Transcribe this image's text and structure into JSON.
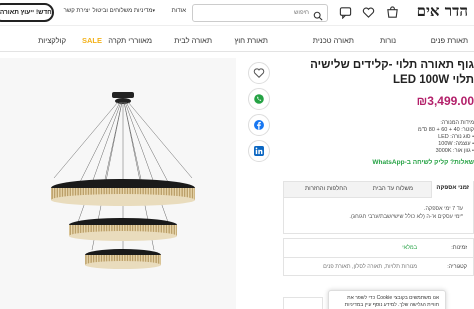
{
  "header": {
    "logo": "הדר אים",
    "search_placeholder": "חיפוש",
    "links": [
      {
        "label": "אודות"
      },
      {
        "label": "מדיניות משלוחים וביטול"
      },
      {
        "label": "יצירת קשר"
      }
    ],
    "cta": "חדש! ייעוץ תאורה ל"
  },
  "nav": {
    "items": [
      "תאורת פנים",
      "נורות",
      "תאורה טכנית",
      "תאורת חוץ",
      "תאורה לבית",
      "מאווררי תקרה",
      "SALE",
      "קולקציות"
    ]
  },
  "product": {
    "title_line1": "גוף תאורה תלוי -קלידים שלישיה",
    "title_line2": "תלוי LED 100W",
    "price": "₪3,499.00",
    "specs": [
      "מידות המנורה:",
      "קוטר: 40 + 60 + 80 ס\"מ",
      "• סוג נורה: LED",
      "• עוצמה: 100W",
      "• גוון אור: 3000K"
    ],
    "whatsapp": "שאלות? קליק לשיחה ב-WhatsApp"
  },
  "tabs": {
    "items": [
      {
        "label": "זמני אספקה",
        "active": true
      },
      {
        "label": "משלוח עד הבית"
      },
      {
        "label": "החלפות והחזרות"
      }
    ],
    "body": [
      "עד 7 ימי אספקה.",
      "*ימי עסקים א'-ה (לא כולל שישי/שבת/ערבי חג/חג)."
    ]
  },
  "meta": {
    "sku_label": "זמינות:",
    "sku_value": "במלאי",
    "category_label": "קטגוריה:",
    "category_value": "מנורות תלויות, תאורה לסלון, תאורת פנים"
  },
  "cookie": {
    "line1": "אנו משתמשים בקובצי Cookie כדי לשפר את",
    "line2": "חוויית הגלישה שלך. למידע נוסף עיין במדיניות"
  },
  "icons": {
    "user": "user-icon",
    "chat": "chat-icon",
    "heart": "heart-icon",
    "cart": "cart-icon",
    "search": "search-icon"
  },
  "colors": {
    "price": "#b3206a",
    "sale": "#f3b11a",
    "whatsapp": "#25a244",
    "facebook": "#1877f2",
    "linkedin": "#0a66c2"
  }
}
